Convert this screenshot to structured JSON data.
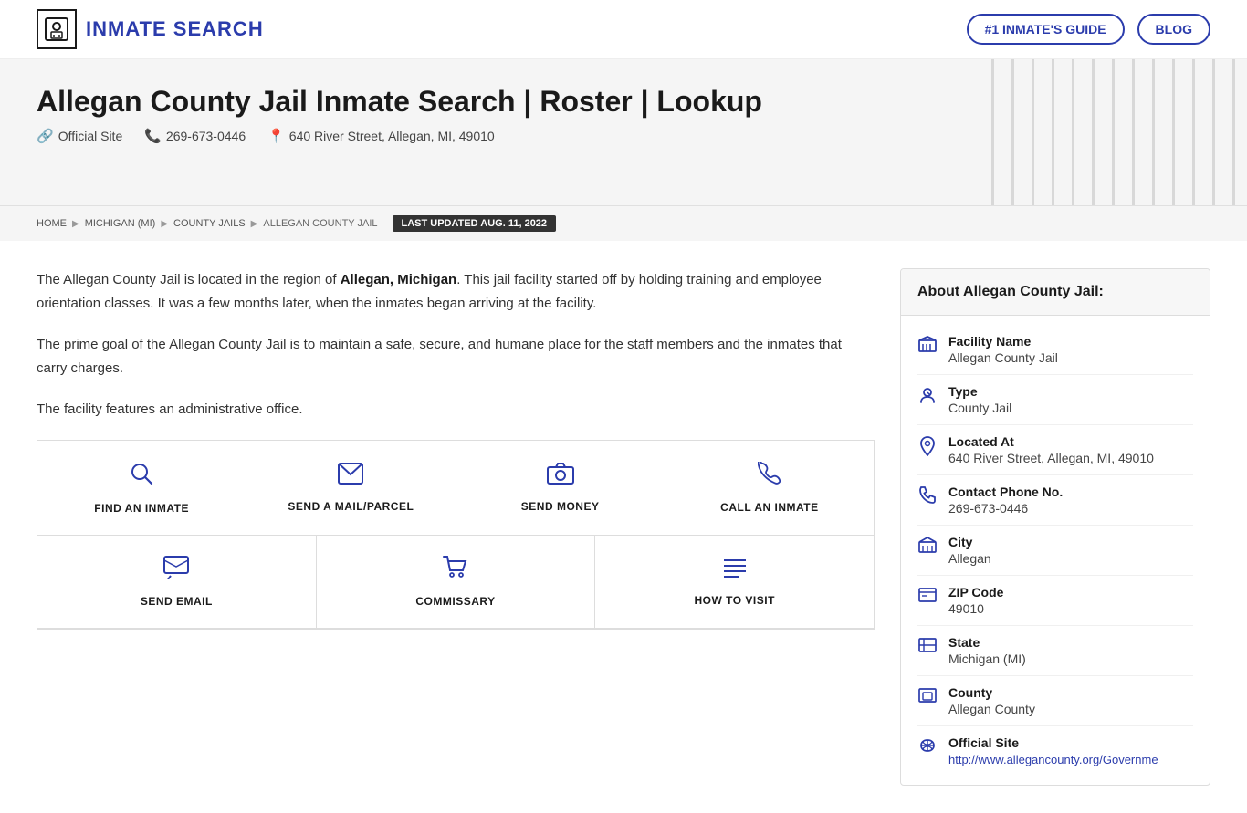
{
  "header": {
    "logo_text": "INMATE SEARCH",
    "logo_icon": "🔒",
    "nav_guide": "#1 INMATE'S GUIDE",
    "nav_blog": "BLOG"
  },
  "hero": {
    "title": "Allegan County Jail Inmate Search | Roster | Lookup",
    "official_site_label": "Official Site",
    "phone": "269-673-0446",
    "address": "640 River Street, Allegan, MI, 49010"
  },
  "breadcrumb": {
    "items": [
      "HOME",
      "MICHIGAN (MI)",
      "COUNTY JAILS",
      "ALLEGAN COUNTY JAIL"
    ],
    "last_updated": "LAST UPDATED AUG. 11, 2022"
  },
  "content": {
    "para1": "The Allegan County Jail is located in the region of Allegan, Michigan. This jail facility started off by holding training and employee orientation classes. It was a few months later, when the inmates began arriving at the facility.",
    "para1_bold": "Allegan, Michigan",
    "para2": "The prime goal of the Allegan County Jail is to maintain a safe, secure, and humane place for the staff members and the inmates that carry charges.",
    "para3": "The facility features an administrative office."
  },
  "actions": {
    "row1": [
      {
        "label": "FIND AN INMATE",
        "icon": "search"
      },
      {
        "label": "SEND A MAIL/PARCEL",
        "icon": "mail"
      },
      {
        "label": "SEND MONEY",
        "icon": "camera"
      },
      {
        "label": "CALL AN INMATE",
        "icon": "phone"
      }
    ],
    "row2": [
      {
        "label": "SEND EMAIL",
        "icon": "chat"
      },
      {
        "label": "COMMISSARY",
        "icon": "cart"
      },
      {
        "label": "HOW TO VISIT",
        "icon": "list"
      }
    ]
  },
  "sidebar": {
    "title": "About Allegan County Jail:",
    "rows": [
      {
        "label": "Facility Name",
        "value": "Allegan County Jail",
        "icon": "facility"
      },
      {
        "label": "Type",
        "value": "County Jail",
        "icon": "type"
      },
      {
        "label": "Located At",
        "value": "640 River Street, Allegan, MI, 49010",
        "icon": "location"
      },
      {
        "label": "Contact Phone No.",
        "value": "269-673-0446",
        "icon": "phone"
      },
      {
        "label": "City",
        "value": "Allegan",
        "icon": "city"
      },
      {
        "label": "ZIP Code",
        "value": "49010",
        "icon": "zip"
      },
      {
        "label": "State",
        "value": "Michigan (MI)",
        "icon": "state"
      },
      {
        "label": "County",
        "value": "Allegan County",
        "icon": "county"
      },
      {
        "label": "Official Site",
        "value": "http://www.allegancounty.org/Governme",
        "icon": "link",
        "is_link": true
      }
    ]
  }
}
